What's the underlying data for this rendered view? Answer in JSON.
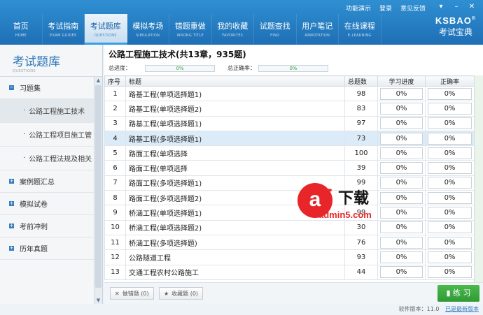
{
  "top_links": [
    "功能演示",
    "登录",
    "意见反馈"
  ],
  "window_controls": [
    "▾",
    "–",
    "✕"
  ],
  "nav": [
    {
      "label": "首页",
      "sub": "HOME"
    },
    {
      "label": "考试指南",
      "sub": "EXAM GUIDES"
    },
    {
      "label": "考试题库",
      "sub": "QUESTIONS"
    },
    {
      "label": "模拟考场",
      "sub": "SIMULATION"
    },
    {
      "label": "错题重做",
      "sub": "WRONG TITLE"
    },
    {
      "label": "我的收藏",
      "sub": "FAVORITES"
    },
    {
      "label": "试题查找",
      "sub": "FIND"
    },
    {
      "label": "用户笔记",
      "sub": "ANNOTATION"
    },
    {
      "label": "在线课程",
      "sub": "E-LEARNING"
    }
  ],
  "nav_active_index": 2,
  "logo": {
    "line1": "KSBAO",
    "mark": "®",
    "line2": "考试宝典"
  },
  "sidebar": {
    "title": "考试题库",
    "title_en": "QUESTIONS",
    "groups": [
      {
        "label": "习题集",
        "icon": "minus-icon",
        "expanded": true
      },
      {
        "label": "案例题汇总",
        "icon": "plus-icon"
      },
      {
        "label": "模拟试卷",
        "icon": "plus-icon"
      },
      {
        "label": "考前冲刺",
        "icon": "plus-icon"
      },
      {
        "label": "历年真题",
        "icon": "plus-icon"
      }
    ],
    "subitems": [
      "公路工程施工技术",
      "公路工程项目施工管",
      "公路工程法规及相关"
    ],
    "active_subitem": 0
  },
  "main": {
    "title": "公路工程施工技术(共13章，935题)",
    "total_progress_label": "总进度：",
    "total_progress": "0%",
    "total_accuracy_label": "总正确率：",
    "total_accuracy": "0%"
  },
  "table": {
    "headers": [
      "序号",
      "标题",
      "总题数",
      "学习进度",
      "正确率"
    ],
    "rows": [
      {
        "no": "1",
        "title": "路基工程(单项选择题1)",
        "total": "98",
        "progress": "0%",
        "accuracy": "0%"
      },
      {
        "no": "2",
        "title": "路基工程(单项选择题2)",
        "total": "83",
        "progress": "0%",
        "accuracy": "0%"
      },
      {
        "no": "3",
        "title": "路基工程(单项选择题1)",
        "total": "97",
        "progress": "0%",
        "accuracy": "0%"
      },
      {
        "no": "4",
        "title": "路基工程(多项选择题1)",
        "total": "73",
        "progress": "0%",
        "accuracy": "0%"
      },
      {
        "no": "5",
        "title": "路面工程(单项选择",
        "total": "100",
        "progress": "0%",
        "accuracy": "0%"
      },
      {
        "no": "6",
        "title": "路面工程(单项选择",
        "total": "39",
        "progress": "0%",
        "accuracy": "0%"
      },
      {
        "no": "7",
        "title": "路面工程(多项选择题1)",
        "total": "99",
        "progress": "0%",
        "accuracy": "0%"
      },
      {
        "no": "8",
        "title": "路面工程(多项选择题2)",
        "total": "4",
        "progress": "0%",
        "accuracy": "0%"
      },
      {
        "no": "9",
        "title": "桥涵工程(单项选择题1)",
        "total": "99",
        "progress": "0%",
        "accuracy": "0%"
      },
      {
        "no": "10",
        "title": "桥涵工程(单项选择题2)",
        "total": "30",
        "progress": "0%",
        "accuracy": "0%"
      },
      {
        "no": "11",
        "title": "桥涵工程(多项选择题)",
        "total": "76",
        "progress": "0%",
        "accuracy": "0%"
      },
      {
        "no": "12",
        "title": "公路隧道工程",
        "total": "93",
        "progress": "0%",
        "accuracy": "0%"
      },
      {
        "no": "13",
        "title": "交通工程农村公路施工",
        "total": "44",
        "progress": "0%",
        "accuracy": "0%"
      }
    ],
    "selected_row": 3
  },
  "bottom": {
    "wrong_btn": "做错题 (0)",
    "fav_btn": "收藏题 (0)",
    "practice_btn": "练 习"
  },
  "status": {
    "version_label": "软件版本：11.0",
    "update_link": "已是最新版本"
  },
  "watermark": {
    "a": "a",
    "five": "5",
    "dl": "下载",
    "site": "admin5.com"
  }
}
